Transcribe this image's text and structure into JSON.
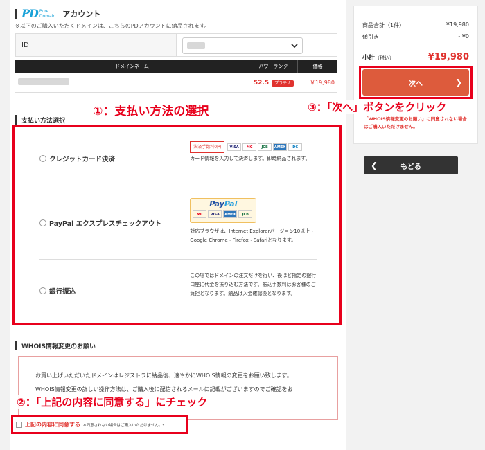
{
  "account": {
    "logo_main": "PD",
    "logo_sub1": "Pure",
    "logo_sub2": "Domain",
    "title": "アカウント",
    "note": "※以下のご購入いただくドメインは、こちらのPDアカウントに納品されます。",
    "id_label": "ID"
  },
  "domain_table": {
    "headers": [
      "ドメインネーム",
      "パワーランク",
      "価格"
    ],
    "row": {
      "rank": "52.5",
      "rank_badge": "プラチナ",
      "price": "￥19,980"
    }
  },
  "payment": {
    "section_title": "支払い方法選択",
    "methods": [
      {
        "label": "クレジットカード決済",
        "fee_badge": "決済手数料0円",
        "cards": [
          "VISA",
          "MC",
          "JCB",
          "AMEX",
          "DC"
        ],
        "desc": "カード情報を入力して決済します。即時納品されます。"
      },
      {
        "label": "PayPal エクスプレスチェックアウト",
        "logo_a": "Pay",
        "logo_b": "Pal",
        "cards": [
          "MC",
          "VISA",
          "AMEX",
          "JCB"
        ],
        "desc": "対応ブラウザは、Internet Explorerバージョン10以上・Google Chrome・Firefox・Safariとなります。"
      },
      {
        "label": "銀行振込",
        "desc": "この場ではドメインの注文だけを行い、後ほど指定の銀行口座に代金を振り込む方法です。振込手数料はお客様のご負担となります。納品は入金確認後となります。"
      }
    ]
  },
  "whois": {
    "section_title": "WHOIS情報変更のお願い",
    "line1": "お買い上げいただいたドメインはレジストラに納品後、速やかにWHOIS情報の変更をお願い致します。",
    "line2": "WHOIS情報変更の詳しい操作方法は、ご購入後に配信されるメールに記載がございますのでご確認をお",
    "agree_label": "上記の内容に同意する",
    "agree_note": "※同意されない場合はご購入いただけません。*"
  },
  "annotations": {
    "step1": "①：支払い方法の選択",
    "step2": "②：「上記の内容に同意する」にチェック",
    "step3": "③：「次へ」ボタンをクリック"
  },
  "summary": {
    "items_label": "商品合計（1件）",
    "items_value": "¥19,980",
    "discount_label": "値引き",
    "discount_value": "- ¥0",
    "subtotal_label": "小計",
    "subtotal_tax": "（税込）",
    "subtotal_value": "¥19,980",
    "next_label": "次へ",
    "warn_text": "「WHOIS情報変更のお願い」に同意されない場合はご購入いただけません。",
    "back_label": "もどる"
  },
  "colors": {
    "accent_red": "#e8001c",
    "next_button": "#dd5b3c",
    "logo_blue": "#1aa2d8"
  }
}
